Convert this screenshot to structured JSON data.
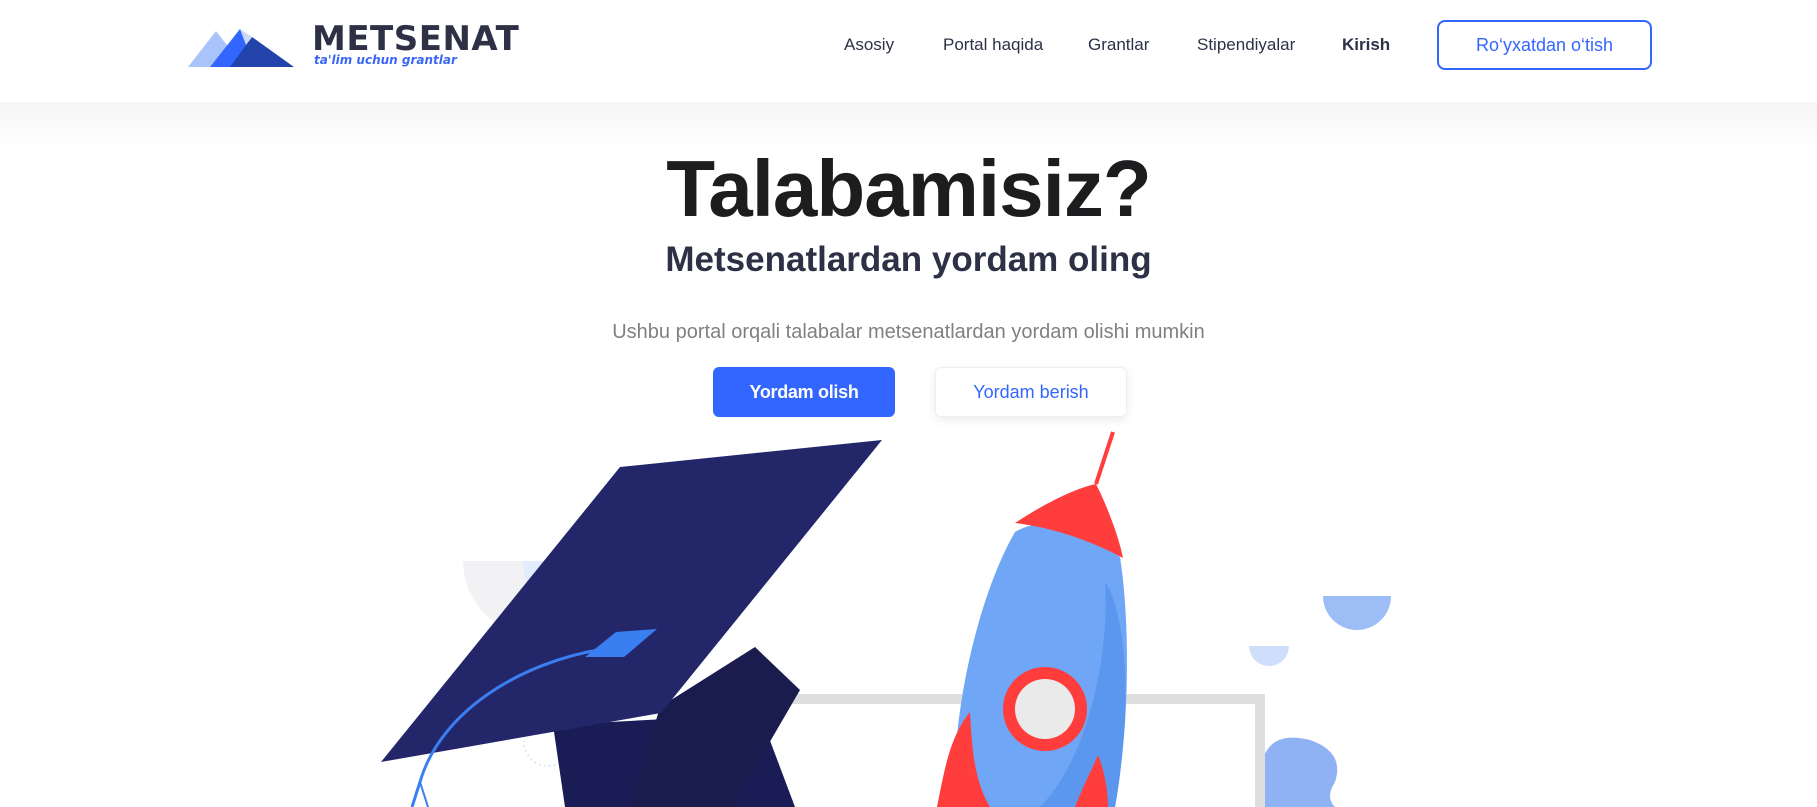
{
  "brand": {
    "title": "METSENAT",
    "subtitle": "ta'lim uchun grantlar"
  },
  "nav": {
    "items": [
      {
        "label": "Asosiy"
      },
      {
        "label": "Portal haqida"
      },
      {
        "label": "Grantlar"
      },
      {
        "label": "Stipendiyalar"
      },
      {
        "label": "Kirish",
        "active": true
      }
    ],
    "register_label": "Ro‘yxatdan o‘tish"
  },
  "hero": {
    "title": "Talabamisiz?",
    "subtitle": "Metsenatlardan yordam oling",
    "description": "Ushbu portal orqali talabalar metsenatlardan yordam olishi mumkin",
    "primary_button": "Yordam olish",
    "secondary_button": "Yordam berish"
  },
  "colors": {
    "accent": "#3366ff",
    "brand_dark": "#2e3146",
    "cap_navy": "#23276a",
    "rocket_red": "#ff3d3d",
    "rocket_blue": "#6fa6f5"
  },
  "icons": [
    "logo-mountains-icon",
    "graduation-cap-illustration",
    "rocket-illustration"
  ]
}
